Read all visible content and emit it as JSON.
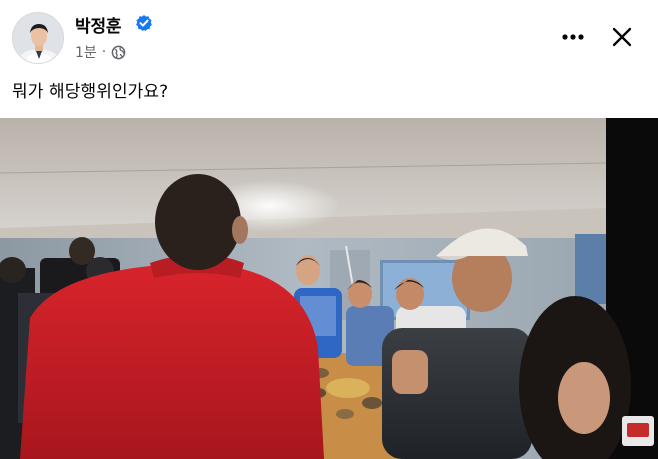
{
  "post": {
    "author_name": "박정훈",
    "verified": true,
    "timestamp": "1분",
    "separator": "·",
    "audience_icon": "globe-icon",
    "text": "뭐가 해당행위인가요?"
  },
  "actions": {
    "more_icon": "more-horizontal-icon",
    "close_icon": "close-icon"
  },
  "colors": {
    "verified_badge": "#1877f2",
    "meta_text": "#65676b",
    "name_text": "#050505"
  }
}
